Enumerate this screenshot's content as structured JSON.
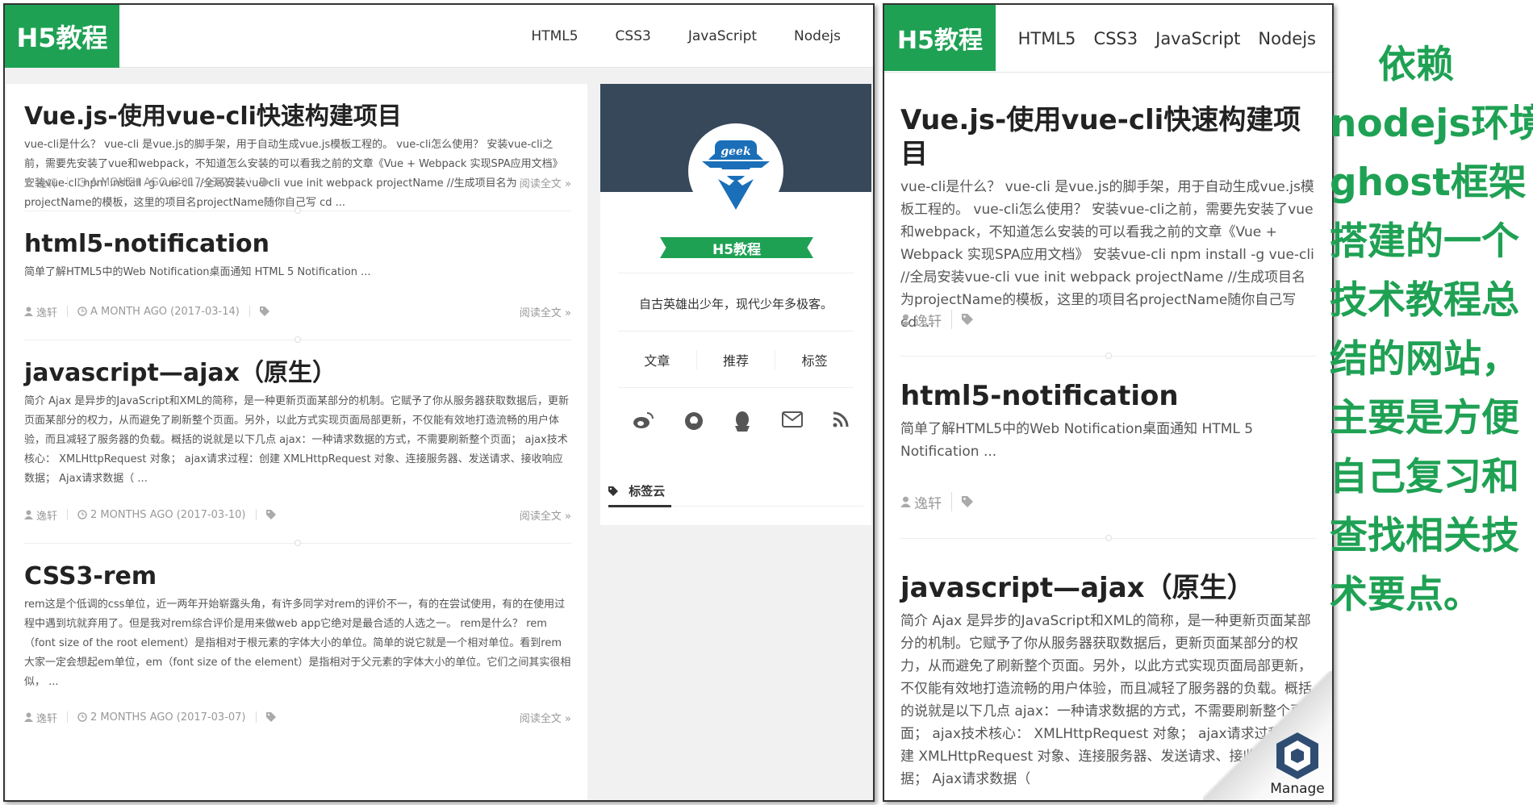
{
  "site": {
    "logo": "H5教程",
    "nav": [
      "HTML5",
      "CSS3",
      "JavaScript",
      "Nodejs"
    ]
  },
  "posts": [
    {
      "title": "Vue.js-使用vue-cli快速构建项目",
      "excerpt": "vue-cli是什么？ vue-cli 是vue.js的脚手架，用于自动生成vue.js模板工程的。 vue-cli怎么使用？ 安装vue-cli之前，需要先安装了vue和webpack，不知道怎么安装的可以看我之前的文章《Vue + Webpack 实现SPA应用文档》 安装vue-cli npm install -g vue-cli //全局安装vue-cli vue init webpack projectName //生成项目名为projectName的模板，这里的项目名projectName随你自己写 cd ...",
      "author": "逸轩",
      "date": "A MONTH AGO (2017-03-23)",
      "more": "阅读全文 »"
    },
    {
      "title": "html5-notification",
      "excerpt": "简单了解HTML5中的Web Notification桌面通知 HTML 5 Notification ...",
      "author": "逸轩",
      "date": "A MONTH AGO (2017-03-14)",
      "more": "阅读全文 »"
    },
    {
      "title": "javascript—ajax（原生）",
      "excerpt": "简介 Ajax 是异步的JavaScript和XML的简称，是一种更新页面某部分的机制。它赋予了你从服务器获取数据后，更新页面某部分的权力，从而避免了刷新整个页面。另外，以此方式实现页面局部更新，不仅能有效地打造流畅的用户体验，而且减轻了服务器的负载。概括的说就是以下几点 ajax：一种请求数据的方式，不需要刷新整个页面； ajax技术核心： XMLHttpRequest 对象； ajax请求过程：创建 XMLHttpRequest 对象、连接服务器、发送请求、接收响应数据； Ajax请求数据（ ...",
      "author": "逸轩",
      "date": "2 MONTHS AGO (2017-03-10)",
      "more": "阅读全文 »"
    },
    {
      "title": "CSS3-rem",
      "excerpt": "rem这是个低调的css单位，近一两年开始崭露头角，有许多同学对rem的评价不一，有的在尝试使用，有的在使用过程中遇到坑就弃用了。但是我对rem综合评价是用来做web app它绝对是最合适的人选之一。 rem是什么？ rem（font size of the root element）是指相对于根元素的字体大小的单位。简单的说它就是一个相对单位。看到rem大家一定会想起em单位，em（font size of the element）是指相对于父元素的字体大小的单位。它们之间其实很相似， ...",
      "author": "逸轩",
      "date": "2 MONTHS AGO (2017-03-07)",
      "more": "阅读全文 »"
    }
  ],
  "mobile_posts": [
    {
      "title": "Vue.js-使用vue-cli快速构建项目",
      "excerpt": "vue-cli是什么？ vue-cli 是vue.js的脚手架，用于自动生成vue.js模板工程的。 vue-cli怎么使用？ 安装vue-cli之前，需要先安装了vue和webpack，不知道怎么安装的可以看我之前的文章《Vue + Webpack 实现SPA应用文档》 安装vue-cli npm install -g vue-cli //全局安装vue-cli vue init webpack projectName //生成项目名为projectName的模板，这里的项目名projectName随你自己写 cd ...",
      "author": "逸轩"
    },
    {
      "title": "html5-notification",
      "excerpt": "简单了解HTML5中的Web Notification桌面通知 HTML 5 Notification ...",
      "author": "逸轩"
    },
    {
      "title": "javascript—ajax（原生）",
      "excerpt": "简介 Ajax 是异步的JavaScript和XML的简称，是一种更新页面某部分的机制。它赋予了你从服务器获取数据后，更新页面某部分的权力，从而避免了刷新整个页面。另外，以此方式实现页面局部更新，不仅能有效地打造流畅的用户体验，而且减轻了服务器的负载。概括的说就是以下几点 ajax：一种请求数据的方式，不需要刷新整个页面； ajax技术核心： XMLHttpRequest 对象； ajax请求过程：创建 XMLHttpRequest 对象、连接服务器、发送请求、接收响应数据； Ajax请求数据（"
    }
  ],
  "sidebar": {
    "avatar_text": "geek",
    "name": "H5教程",
    "motto": "自古英雄出少年，现代少年多极客。",
    "tabs": [
      "文章",
      "推荐",
      "标签"
    ],
    "social_icons": [
      "weibo-icon",
      "github-icon",
      "qq-icon",
      "mail-icon",
      "rss-icon"
    ],
    "tagcloud_title": "标签云"
  },
  "manage_label": "Manage",
  "caption": [
    "依赖",
    "nodejs环境",
    "ghost框架",
    "搭建的一个",
    "技术教程总",
    "结的网站，",
    "主要是方便",
    "自己复习和",
    "查找相关技",
    "术要点。"
  ],
  "colors": {
    "brand": "#1fa154",
    "sidebar_header": "#37485b",
    "text_meta": "#999999"
  }
}
